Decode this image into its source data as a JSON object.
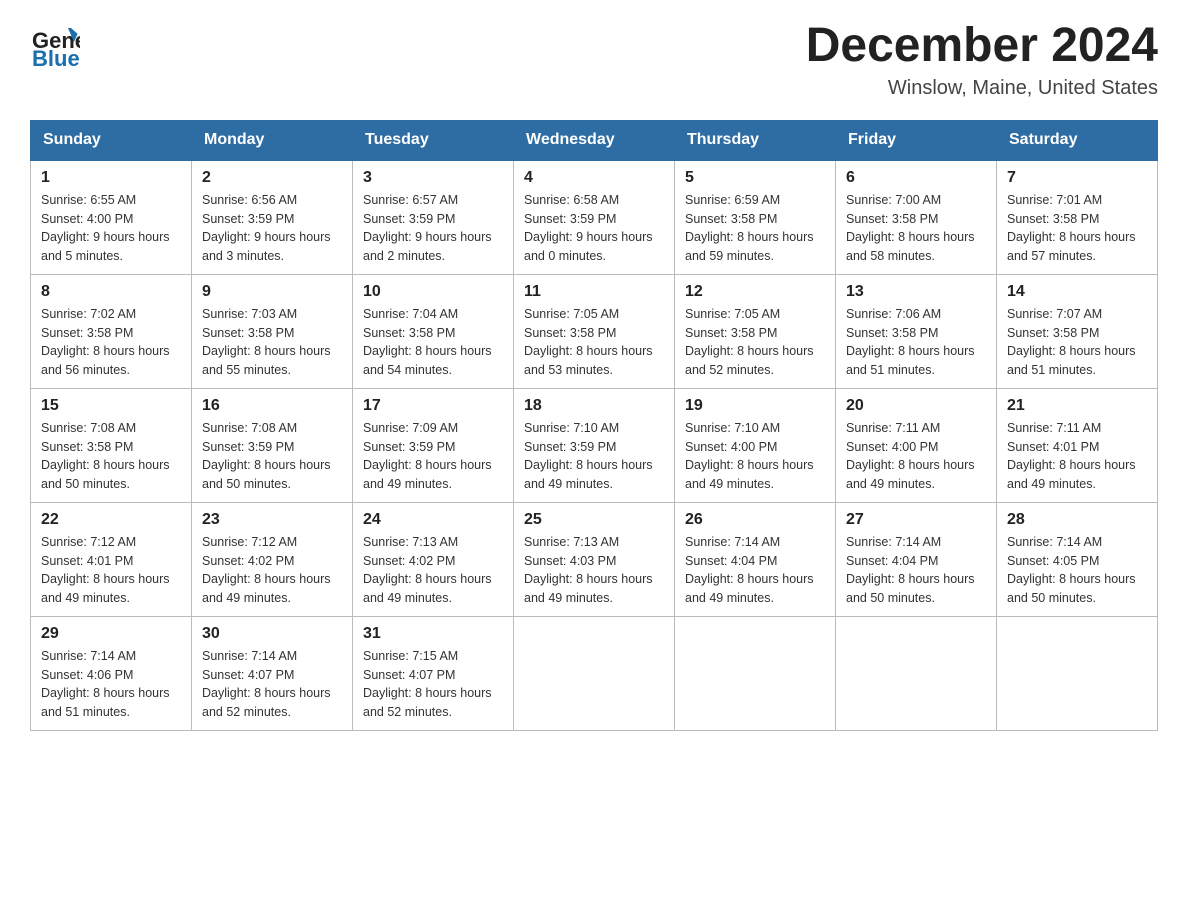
{
  "header": {
    "logo_general": "General",
    "logo_blue": "Blue",
    "title": "December 2024",
    "subtitle": "Winslow, Maine, United States"
  },
  "weekdays": [
    "Sunday",
    "Monday",
    "Tuesday",
    "Wednesday",
    "Thursday",
    "Friday",
    "Saturday"
  ],
  "weeks": [
    [
      {
        "day": "1",
        "sunrise": "6:55 AM",
        "sunset": "4:00 PM",
        "daylight": "9 hours and 5 minutes."
      },
      {
        "day": "2",
        "sunrise": "6:56 AM",
        "sunset": "3:59 PM",
        "daylight": "9 hours and 3 minutes."
      },
      {
        "day": "3",
        "sunrise": "6:57 AM",
        "sunset": "3:59 PM",
        "daylight": "9 hours and 2 minutes."
      },
      {
        "day": "4",
        "sunrise": "6:58 AM",
        "sunset": "3:59 PM",
        "daylight": "9 hours and 0 minutes."
      },
      {
        "day": "5",
        "sunrise": "6:59 AM",
        "sunset": "3:58 PM",
        "daylight": "8 hours and 59 minutes."
      },
      {
        "day": "6",
        "sunrise": "7:00 AM",
        "sunset": "3:58 PM",
        "daylight": "8 hours and 58 minutes."
      },
      {
        "day": "7",
        "sunrise": "7:01 AM",
        "sunset": "3:58 PM",
        "daylight": "8 hours and 57 minutes."
      }
    ],
    [
      {
        "day": "8",
        "sunrise": "7:02 AM",
        "sunset": "3:58 PM",
        "daylight": "8 hours and 56 minutes."
      },
      {
        "day": "9",
        "sunrise": "7:03 AM",
        "sunset": "3:58 PM",
        "daylight": "8 hours and 55 minutes."
      },
      {
        "day": "10",
        "sunrise": "7:04 AM",
        "sunset": "3:58 PM",
        "daylight": "8 hours and 54 minutes."
      },
      {
        "day": "11",
        "sunrise": "7:05 AM",
        "sunset": "3:58 PM",
        "daylight": "8 hours and 53 minutes."
      },
      {
        "day": "12",
        "sunrise": "7:05 AM",
        "sunset": "3:58 PM",
        "daylight": "8 hours and 52 minutes."
      },
      {
        "day": "13",
        "sunrise": "7:06 AM",
        "sunset": "3:58 PM",
        "daylight": "8 hours and 51 minutes."
      },
      {
        "day": "14",
        "sunrise": "7:07 AM",
        "sunset": "3:58 PM",
        "daylight": "8 hours and 51 minutes."
      }
    ],
    [
      {
        "day": "15",
        "sunrise": "7:08 AM",
        "sunset": "3:58 PM",
        "daylight": "8 hours and 50 minutes."
      },
      {
        "day": "16",
        "sunrise": "7:08 AM",
        "sunset": "3:59 PM",
        "daylight": "8 hours and 50 minutes."
      },
      {
        "day": "17",
        "sunrise": "7:09 AM",
        "sunset": "3:59 PM",
        "daylight": "8 hours and 49 minutes."
      },
      {
        "day": "18",
        "sunrise": "7:10 AM",
        "sunset": "3:59 PM",
        "daylight": "8 hours and 49 minutes."
      },
      {
        "day": "19",
        "sunrise": "7:10 AM",
        "sunset": "4:00 PM",
        "daylight": "8 hours and 49 minutes."
      },
      {
        "day": "20",
        "sunrise": "7:11 AM",
        "sunset": "4:00 PM",
        "daylight": "8 hours and 49 minutes."
      },
      {
        "day": "21",
        "sunrise": "7:11 AM",
        "sunset": "4:01 PM",
        "daylight": "8 hours and 49 minutes."
      }
    ],
    [
      {
        "day": "22",
        "sunrise": "7:12 AM",
        "sunset": "4:01 PM",
        "daylight": "8 hours and 49 minutes."
      },
      {
        "day": "23",
        "sunrise": "7:12 AM",
        "sunset": "4:02 PM",
        "daylight": "8 hours and 49 minutes."
      },
      {
        "day": "24",
        "sunrise": "7:13 AM",
        "sunset": "4:02 PM",
        "daylight": "8 hours and 49 minutes."
      },
      {
        "day": "25",
        "sunrise": "7:13 AM",
        "sunset": "4:03 PM",
        "daylight": "8 hours and 49 minutes."
      },
      {
        "day": "26",
        "sunrise": "7:14 AM",
        "sunset": "4:04 PM",
        "daylight": "8 hours and 49 minutes."
      },
      {
        "day": "27",
        "sunrise": "7:14 AM",
        "sunset": "4:04 PM",
        "daylight": "8 hours and 50 minutes."
      },
      {
        "day": "28",
        "sunrise": "7:14 AM",
        "sunset": "4:05 PM",
        "daylight": "8 hours and 50 minutes."
      }
    ],
    [
      {
        "day": "29",
        "sunrise": "7:14 AM",
        "sunset": "4:06 PM",
        "daylight": "8 hours and 51 minutes."
      },
      {
        "day": "30",
        "sunrise": "7:14 AM",
        "sunset": "4:07 PM",
        "daylight": "8 hours and 52 minutes."
      },
      {
        "day": "31",
        "sunrise": "7:15 AM",
        "sunset": "4:07 PM",
        "daylight": "8 hours and 52 minutes."
      },
      null,
      null,
      null,
      null
    ]
  ],
  "labels": {
    "sunrise": "Sunrise:",
    "sunset": "Sunset:",
    "daylight": "Daylight:"
  }
}
